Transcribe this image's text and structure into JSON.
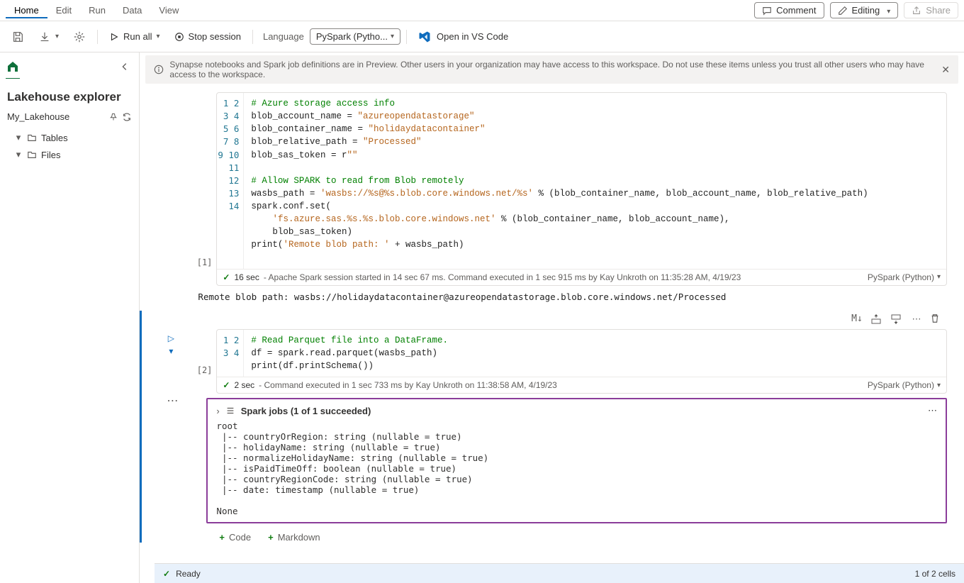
{
  "menu": {
    "items": [
      "Home",
      "Edit",
      "Run",
      "Data",
      "View"
    ],
    "active": 0
  },
  "topbuttons": {
    "comment": "Comment",
    "editing": "Editing",
    "share": "Share"
  },
  "toolbar": {
    "runall": "Run all",
    "stop": "Stop session",
    "langlabel": "Language",
    "langvalue": "PySpark (Pytho...",
    "vscode": "Open in VS Code"
  },
  "sidebar": {
    "title": "Lakehouse explorer",
    "lakehouse": "My_Lakehouse",
    "nodes": [
      "Tables",
      "Files"
    ]
  },
  "infobar": {
    "text": "Synapse notebooks and Spark job definitions are in Preview. Other users in your organization may have access to this workspace. Do not use these items unless you trust all other users who may have access to the workspace."
  },
  "cell1": {
    "exec": "[1]",
    "code_lines": [
      {
        "t": "# Azure storage access info",
        "cls": "c-comment"
      },
      {
        "t": "blob_account_name = \"azureopendatastorage\"",
        "mix": true,
        "parts": [
          {
            "t": "blob_account_name = "
          },
          {
            "t": "\"azureopendatastorage\"",
            "cls": "c-str"
          }
        ]
      },
      {
        "t": "blob_container_name = \"holidaydatacontainer\"",
        "mix": true,
        "parts": [
          {
            "t": "blob_container_name = "
          },
          {
            "t": "\"holidaydatacontainer\"",
            "cls": "c-str"
          }
        ]
      },
      {
        "t": "blob_relative_path = \"Processed\"",
        "mix": true,
        "parts": [
          {
            "t": "blob_relative_path = "
          },
          {
            "t": "\"Processed\"",
            "cls": "c-str"
          }
        ]
      },
      {
        "t": "blob_sas_token = r\"\"",
        "mix": true,
        "parts": [
          {
            "t": "blob_sas_token = r"
          },
          {
            "t": "\"\"",
            "cls": "c-str"
          }
        ]
      },
      {
        "t": ""
      },
      {
        "t": "# Allow SPARK to read from Blob remotely",
        "cls": "c-comment"
      },
      {
        "t": "wasbs_path = 'wasbs://%s@%s.blob.core.windows.net/%s' % (blob_container_name, blob_account_name, blob_relative_path)",
        "mix": true,
        "parts": [
          {
            "t": "wasbs_path = "
          },
          {
            "t": "'wasbs://%s@%s.blob.core.windows.net/%s'",
            "cls": "c-str"
          },
          {
            "t": " % (blob_container_name, blob_account_name, blob_relative_path)"
          }
        ]
      },
      {
        "t": "spark.conf.set("
      },
      {
        "t": "    'fs.azure.sas.%s.%s.blob.core.windows.net' % (blob_container_name, blob_account_name),",
        "mix": true,
        "parts": [
          {
            "t": "    "
          },
          {
            "t": "'fs.azure.sas.%s.%s.blob.core.windows.net'",
            "cls": "c-str"
          },
          {
            "t": " % (blob_container_name, blob_account_name),"
          }
        ]
      },
      {
        "t": "    blob_sas_token)"
      },
      {
        "t": "print('Remote blob path: ' + wasbs_path)",
        "mix": true,
        "parts": [
          {
            "t": "print("
          },
          {
            "t": "'Remote blob path: '",
            "cls": "c-str"
          },
          {
            "t": " + wasbs_path)"
          }
        ]
      },
      {
        "t": ""
      },
      {
        "t": ""
      }
    ],
    "status_time": "16 sec",
    "status_text": "- Apache Spark session started in 14 sec 67 ms. Command executed in 1 sec 915 ms by Kay Unkroth on 11:35:28 AM, 4/19/23",
    "lang": "PySpark (Python)",
    "output": "Remote blob path: wasbs://holidaydatacontainer@azureopendatastorage.blob.core.windows.net/Processed"
  },
  "cell2": {
    "exec": "[2]",
    "code_lines": [
      {
        "t": "# Read Parquet file into a DataFrame.",
        "cls": "c-comment"
      },
      {
        "t": "df = spark.read.parquet(wasbs_path)"
      },
      {
        "t": "print(df.printSchema())"
      },
      {
        "t": ""
      }
    ],
    "status_time": "2 sec",
    "status_text": "- Command executed in 1 sec 733 ms by Kay Unkroth on 11:38:58 AM, 4/19/23",
    "lang": "PySpark (Python)",
    "sparkjobs": "Spark jobs (1 of 1 succeeded)",
    "schema_output": "root\n |-- countryOrRegion: string (nullable = true)\n |-- holidayName: string (nullable = true)\n |-- normalizeHolidayName: string (nullable = true)\n |-- isPaidTimeOff: boolean (nullable = true)\n |-- countryRegionCode: string (nullable = true)\n |-- date: timestamp (nullable = true)\n\nNone",
    "add_code": "Code",
    "add_md": "Markdown"
  },
  "status": {
    "ready": "Ready",
    "cells": "1 of 2 cells"
  }
}
